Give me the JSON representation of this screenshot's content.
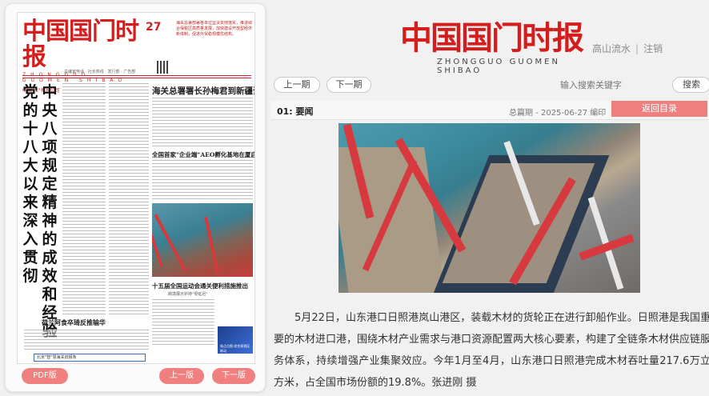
{
  "newspaper": {
    "masthead_title": "中国国门时报",
    "masthead_pinyin": "ZHONGGUO GUOMEN SHIBAO",
    "masthead_sub": "中国11°有限公司",
    "masthead_tagline": "总编室电话 · 社长热线 · 发行部 · 广告部",
    "issue_number": "27",
    "top_news": "海关总署部署各单位坚决贯彻落实，推进综合保税区高质量发展，加快建设开放型经济新体制，促进外贸稳规模优结构。",
    "vertical_headline_a": "党的十八大以来深入贯彻",
    "vertical_headline_b": "中央八项规定精神的成效和经验",
    "headline_1": "海关总署署长孙梅君到新疆调研",
    "headline_2": "全国首家\"企业端\"AEO孵化基地在厦启用",
    "headline_3": "十五届全国运动会通关便利措施推出",
    "headline_3_sub": "跨境展示护持\"零延迟\"",
    "headline_4": "荷兰阿食卒琦反推输华",
    "banner_text": "吸点点图 综合保税区联动",
    "search_text": "北京\"智\"慧海关旧报条",
    "pdf_label": "PDF版",
    "prev_label": "上一版",
    "next_label": "下一版"
  },
  "header": {
    "logo_title": "中国国门时报",
    "logo_pinyin": "ZHONGGUO  GUOMEN  SHIBAO",
    "user_name": "高山流水",
    "logout_label": "注销"
  },
  "toolbar": {
    "prev_issue": "上一期",
    "next_issue": "下一期",
    "search_placeholder": "输入搜索关键字",
    "search_button": "搜索"
  },
  "section": {
    "label": "01: 要闻",
    "meta": "总篇期 - 2025-06-27 编印",
    "back_label": "返回目录"
  },
  "article": {
    "caption": "5月22日，山东港口日照港岚山港区，装载木材的货轮正在进行卸船作业。日照港是我国重要的木材进口港，围绕木材产业需求与港口资源配置两大核心要素，构建了全链条木材供应链服务体系，持续增强产业集聚效应。今年1月至4月，山东港口日照港完成木材吞吐量217.6万立方米，占全国市场份额的19.8%。张进刚 摄"
  }
}
